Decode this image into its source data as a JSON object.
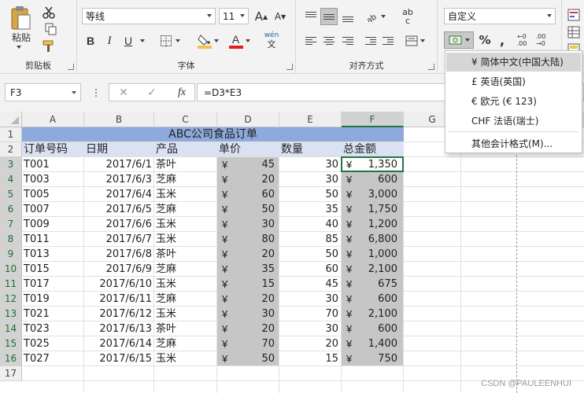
{
  "ribbon": {
    "clipboard": {
      "label": "剪贴板",
      "paste_label": "粘贴"
    },
    "font": {
      "label": "字体",
      "font_name": "等线",
      "font_size": "11",
      "bold": "B",
      "italic": "I",
      "underline": "U",
      "increase_size": "A",
      "decrease_size": "A",
      "font_color_glyph": "A",
      "pinyin_top": "wén",
      "pinyin_bottom": "文"
    },
    "alignment": {
      "label": "对齐方式",
      "wrap_glyph": "ab",
      "wrap_glyph2": "c"
    },
    "number": {
      "format": "自定义",
      "percent": "%",
      "comma": ","
    }
  },
  "formula_bar": {
    "name_box": "F3",
    "cancel_glyph": "✕",
    "enter_glyph": "✓",
    "fx": "fx",
    "formula": "=D3*E3"
  },
  "sheet": {
    "columns": [
      "A",
      "B",
      "C",
      "D",
      "E",
      "F",
      "G"
    ],
    "selected_column": "F",
    "rows": [
      "1",
      "2",
      "3",
      "4",
      "5",
      "6",
      "7",
      "8",
      "9",
      "10",
      "11",
      "12",
      "13",
      "14",
      "15",
      "16",
      "17"
    ],
    "title": "ABC公司食品订单",
    "headers": [
      "订单号码",
      "日期",
      "产品",
      "单价",
      "数量",
      "总金额"
    ],
    "currency_symbol": "¥",
    "data": [
      [
        "T001",
        "2017/6/1",
        "茶叶",
        "45",
        "30",
        "1,350"
      ],
      [
        "T003",
        "2017/6/3",
        "芝麻",
        "20",
        "30",
        "600"
      ],
      [
        "T005",
        "2017/6/4",
        "玉米",
        "60",
        "50",
        "3,000"
      ],
      [
        "T007",
        "2017/6/5",
        "芝麻",
        "50",
        "35",
        "1,750"
      ],
      [
        "T009",
        "2017/6/6",
        "玉米",
        "30",
        "40",
        "1,200"
      ],
      [
        "T011",
        "2017/6/7",
        "玉米",
        "80",
        "85",
        "6,800"
      ],
      [
        "T013",
        "2017/6/8",
        "茶叶",
        "20",
        "50",
        "1,000"
      ],
      [
        "T015",
        "2017/6/9",
        "芝麻",
        "35",
        "60",
        "2,100"
      ],
      [
        "T017",
        "2017/6/10",
        "玉米",
        "15",
        "45",
        "675"
      ],
      [
        "T019",
        "2017/6/11",
        "芝麻",
        "20",
        "30",
        "600"
      ],
      [
        "T021",
        "2017/6/12",
        "玉米",
        "30",
        "70",
        "2,100"
      ],
      [
        "T023",
        "2017/6/13",
        "茶叶",
        "20",
        "30",
        "600"
      ],
      [
        "T025",
        "2017/6/14",
        "芝麻",
        "70",
        "20",
        "1,400"
      ],
      [
        "T027",
        "2017/6/15",
        "玉米",
        "50",
        "15",
        "750"
      ]
    ]
  },
  "currency_dropdown": {
    "items": [
      "¥ 简体中文(中国大陆)",
      "£ 英语(英国)",
      "€ 欧元 (€ 123)",
      "CHF 法语(瑞士)",
      "其他会计格式(M)..."
    ],
    "highlighted_index": 0
  },
  "colors": {
    "title_fill": "#8ea9db",
    "header_fill": "#d9e1f2",
    "selection_fill": "#c6c6c6",
    "accent_green": "#217346"
  },
  "watermark": "CSDN @PAULEENHUI"
}
